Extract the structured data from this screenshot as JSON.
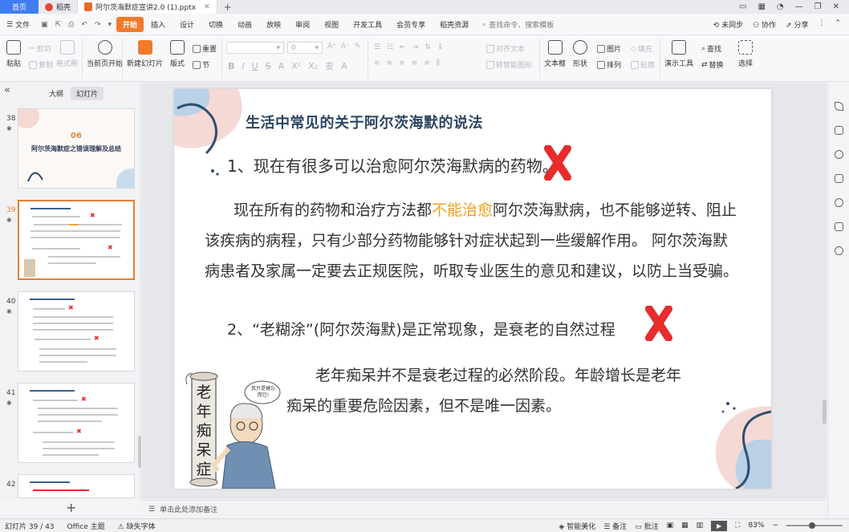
{
  "tabs": {
    "home": "首页",
    "docer": "稻壳",
    "file": "阿尔茨海默症宣讲2.0 (1).pptx"
  },
  "menubar": {
    "file": "文件",
    "items": [
      "开始",
      "插入",
      "设计",
      "切换",
      "动画",
      "放映",
      "审阅",
      "视图",
      "开发工具",
      "会员专享",
      "稻壳资源"
    ],
    "search": "查找命令、搜索模板",
    "sync": "未同步",
    "collab": "协作",
    "share": "分享"
  },
  "ribbon": {
    "paste": "粘贴",
    "cut": "剪切",
    "copy": "复制",
    "format_painter": "格式刷",
    "from_current": "当前页开始",
    "new_slide": "新建幻灯片",
    "layout": "版式",
    "section": "节",
    "reset": "重置",
    "font_size": "0",
    "align_text": "对齐文本",
    "smart_graphic": "转智能图形",
    "textbox": "文本框",
    "shape": "形状",
    "picture": "图片",
    "arrange": "排列",
    "fill": "填充",
    "outline": "轮廓",
    "presenter_tools": "演示工具",
    "find": "查找",
    "replace": "替换",
    "select": "选择"
  },
  "leftpanel": {
    "tab_outline": "大纲",
    "tab_slides": "幻灯片",
    "slides": [
      {
        "num": "38",
        "heading_num": "06",
        "heading": "阿尔茨海默症之错误理解及总结"
      },
      {
        "num": "39"
      },
      {
        "num": "40"
      },
      {
        "num": "41"
      },
      {
        "num": "42"
      }
    ]
  },
  "slide": {
    "title": "生活中常见的关于阿尔茨海默的说法",
    "point1": "1、现在有很多可以治愈阿尔茨海默病的药物。",
    "para1_before": "现在所有的药物和治疗方法都",
    "para1_highlight": "不能治愈",
    "para1_after": "阿尔茨海默病，也不能够逆转、阻止该疾病的病程，只有少部分药物能够针对症状起到一些缓解作用。 阿尔茨海默病患者及家属一定要去正规医院，听取专业医生的意见和建议，以防上当受骗。",
    "point2": "2、“老糊涂”(阿尔茨海默)是正常现象，是衰老的自然过程",
    "para2": "老年痴呆并不是衰老过程的必然阶段。年龄增长是老年痴呆的重要危险因素，但不是唯一因素。",
    "scroll_text": "老年痴呆症",
    "speech": "我只是健忘而已!"
  },
  "notes": {
    "placeholder": "单击此处添加备注"
  },
  "statusbar": {
    "slide_count": "幻灯片 39 / 43",
    "theme": "Office 主题",
    "missing_font": "缺失字体",
    "beautify": "智能美化",
    "notes": "备注",
    "comments": "批注",
    "zoom": "83%"
  },
  "colors": {
    "accent": "#ef7b2b",
    "home_tab": "#3f7df2",
    "title_blue": "#2c4663",
    "highlight": "#f0a020",
    "cross_red": "#e82b2b"
  }
}
